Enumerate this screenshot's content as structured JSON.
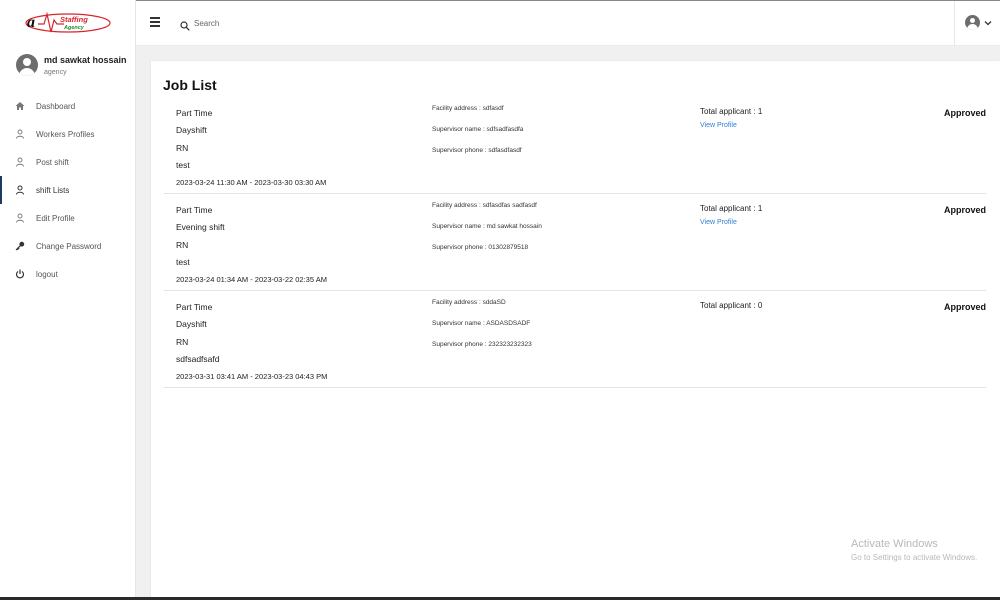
{
  "app": {
    "logo_text": "Staffing Agency",
    "logo_colors": {
      "red": "#d9232a",
      "green": "#1a8f3a",
      "black": "#111111"
    }
  },
  "profile": {
    "name": "md sawkat hossain",
    "role": "agency"
  },
  "sidebar": {
    "items": [
      {
        "label": "Dashboard",
        "icon": "home-icon",
        "active": false
      },
      {
        "label": "Workers Profiles",
        "icon": "person-icon",
        "active": false
      },
      {
        "label": "Post shift",
        "icon": "person-icon",
        "active": false
      },
      {
        "label": "shift Lists",
        "icon": "person-icon",
        "active": true
      },
      {
        "label": "Edit Profile",
        "icon": "person-icon",
        "active": false
      },
      {
        "label": "Change Password",
        "icon": "key-icon",
        "active": false
      },
      {
        "label": "logout",
        "icon": "power-icon",
        "active": false
      }
    ]
  },
  "topbar": {
    "search_placeholder": "Search"
  },
  "main": {
    "title": "Job List",
    "jobs": [
      {
        "type": "Part Time",
        "shift": "Dayshift",
        "role": "RN",
        "note": "test",
        "datetime": "2023-03-24 11:30 AM - 2023-03-30 03:30 AM",
        "facility_address": "Facility address : sdfasdf",
        "supervisor_name": "Supervisor name : sdfsadfasdfa",
        "supervisor_phone": "Supervisor phone : sdfasdfasdf",
        "total_applicant": "Total applicant : 1",
        "view_profile": "View Profile",
        "status": "Approved"
      },
      {
        "type": "Part Time",
        "shift": "Evening shift",
        "role": "RN",
        "note": "test",
        "datetime": "2023-03-24 01:34 AM - 2023-03-22 02:35 AM",
        "facility_address": "Facility address : sdfasdfas sadfasdf",
        "supervisor_name": "Supervisor name : md sawkat hossain",
        "supervisor_phone": "Supervisor phone : 01302879518",
        "total_applicant": "Total applicant : 1",
        "view_profile": "View Profile",
        "status": "Approved"
      },
      {
        "type": "Part Time",
        "shift": "Dayshift",
        "role": "RN",
        "note": "sdfsadfsafd",
        "datetime": "2023-03-31 03:41 AM - 2023-03-23 04:43 PM",
        "facility_address": "Facility address : sddaSD",
        "supervisor_name": "Supervisor name : ASDASDSADF",
        "supervisor_phone": "Supervisor phone : 232323232323",
        "total_applicant": "Total applicant : 0",
        "status": "Approved"
      }
    ]
  },
  "watermark": {
    "line1": "Activate Windows",
    "line2": "Go to Settings to activate Windows."
  },
  "colors": {
    "link": "#2f7fd4",
    "active_nav_border": "#1e3a5f",
    "avatar": "#6d6d6d"
  }
}
